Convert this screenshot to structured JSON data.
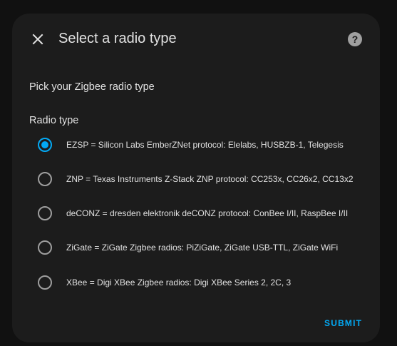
{
  "dialog": {
    "title": "Select a radio type",
    "close_icon": "close-icon",
    "help_icon": "help-circle-icon",
    "subtitle": "Pick your Zigbee radio type",
    "field_label": "Radio type",
    "selected_index": 0,
    "options": [
      {
        "label": "EZSP = Silicon Labs EmberZNet protocol: Elelabs, HUSBZB-1, Telegesis",
        "checked": true
      },
      {
        "label": "ZNP = Texas Instruments Z-Stack ZNP protocol: CC253x, CC26x2, CC13x2",
        "checked": false
      },
      {
        "label": "deCONZ = dresden elektronik deCONZ protocol: ConBee I/II, RaspBee I/II",
        "checked": false
      },
      {
        "label": "ZiGate = ZiGate Zigbee radios: PiZiGate, ZiGate USB-TTL, ZiGate WiFi",
        "checked": false
      },
      {
        "label": "XBee = Digi XBee Zigbee radios: Digi XBee Series 2, 2C, 3",
        "checked": false
      }
    ],
    "submit_label": "SUBMIT",
    "accent_color": "#03a9f4"
  }
}
